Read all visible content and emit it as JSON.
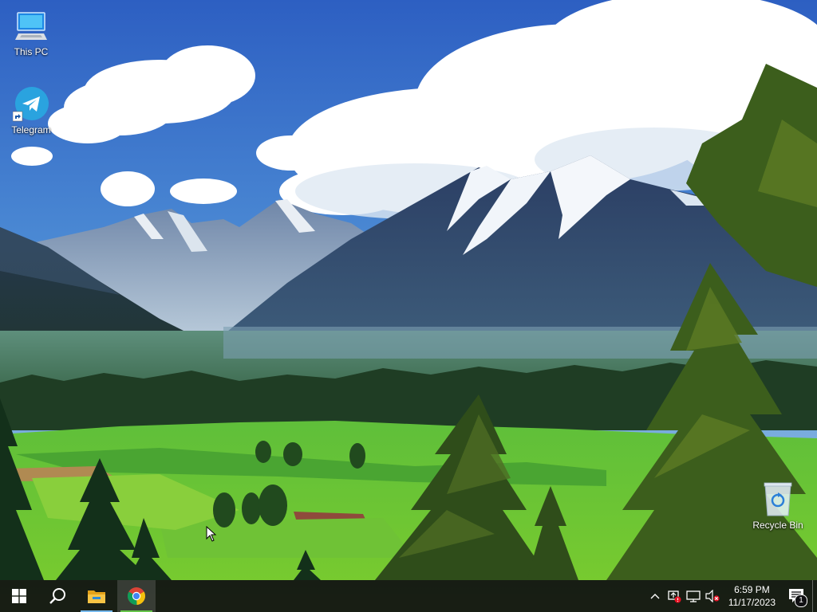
{
  "desktop": {
    "icons": [
      {
        "label": "This PC",
        "icon": "this-pc-icon"
      },
      {
        "label": "Telegram",
        "icon": "telegram-icon"
      },
      {
        "label": "Recycle Bin",
        "icon": "recycle-bin-icon"
      }
    ]
  },
  "taskbar": {
    "start": {
      "icon": "windows-start-icon"
    },
    "search": {
      "icon": "search-icon"
    },
    "apps": [
      {
        "name": "File Explorer",
        "icon": "file-explorer-icon"
      },
      {
        "name": "Google Chrome",
        "icon": "chrome-icon"
      }
    ],
    "tray": {
      "icons": [
        "chevron-up-icon",
        "security-warning-icon",
        "network-icon",
        "volume-muted-icon"
      ],
      "clock": {
        "time": "6:59 PM",
        "date": "11/17/2023"
      },
      "notifications": {
        "icon": "action-center-icon",
        "count": "1"
      }
    }
  },
  "colors": {
    "taskbar_bg": "#101012",
    "accent_blue": "#76b9ed",
    "accent_green": "#66c64a",
    "telegram_blue": "#2aa3df",
    "badge_red": "#e81123"
  }
}
